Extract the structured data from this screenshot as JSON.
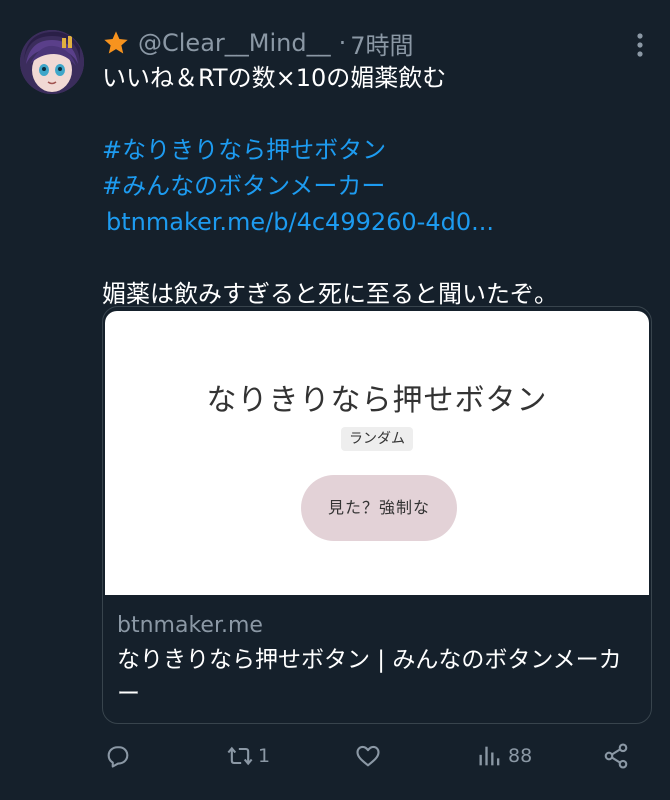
{
  "tweet": {
    "handle": "@Clear__Mind__",
    "separator": "·",
    "time": "7時間",
    "lines": {
      "first": "いいね＆RTの数×10の媚薬飲む",
      "hashtag1": "#なりきりなら押せボタン",
      "hashtag2": "#みんなのボタンメーカー",
      "link": "btnmaker.me/b/4c499260-4d0...",
      "last": "媚薬は飲みすぎると死に至ると聞いたぞ。"
    },
    "badge_icon": "star-icon",
    "avatar_icon": "avatar"
  },
  "card": {
    "preview_title": "なりきりなら押せボタン",
    "preview_badge": "ランダム",
    "preview_button": "見た？強制な",
    "domain": "btnmaker.me",
    "title": "なりきりなら押せボタン | みんなのボタンメーカー"
  },
  "actions": {
    "reply": {
      "icon": "reply-icon",
      "count": ""
    },
    "retweet": {
      "icon": "retweet-icon",
      "count": "1"
    },
    "like": {
      "icon": "heart-icon",
      "count": ""
    },
    "views": {
      "icon": "views-icon",
      "count": "88"
    },
    "share": {
      "icon": "share-icon",
      "count": ""
    }
  },
  "colors": {
    "background": "#15202b",
    "link": "#1d9bf0",
    "muted": "#8b98a5",
    "star": "#f7931e",
    "preview_button": "#e3d2d7"
  }
}
